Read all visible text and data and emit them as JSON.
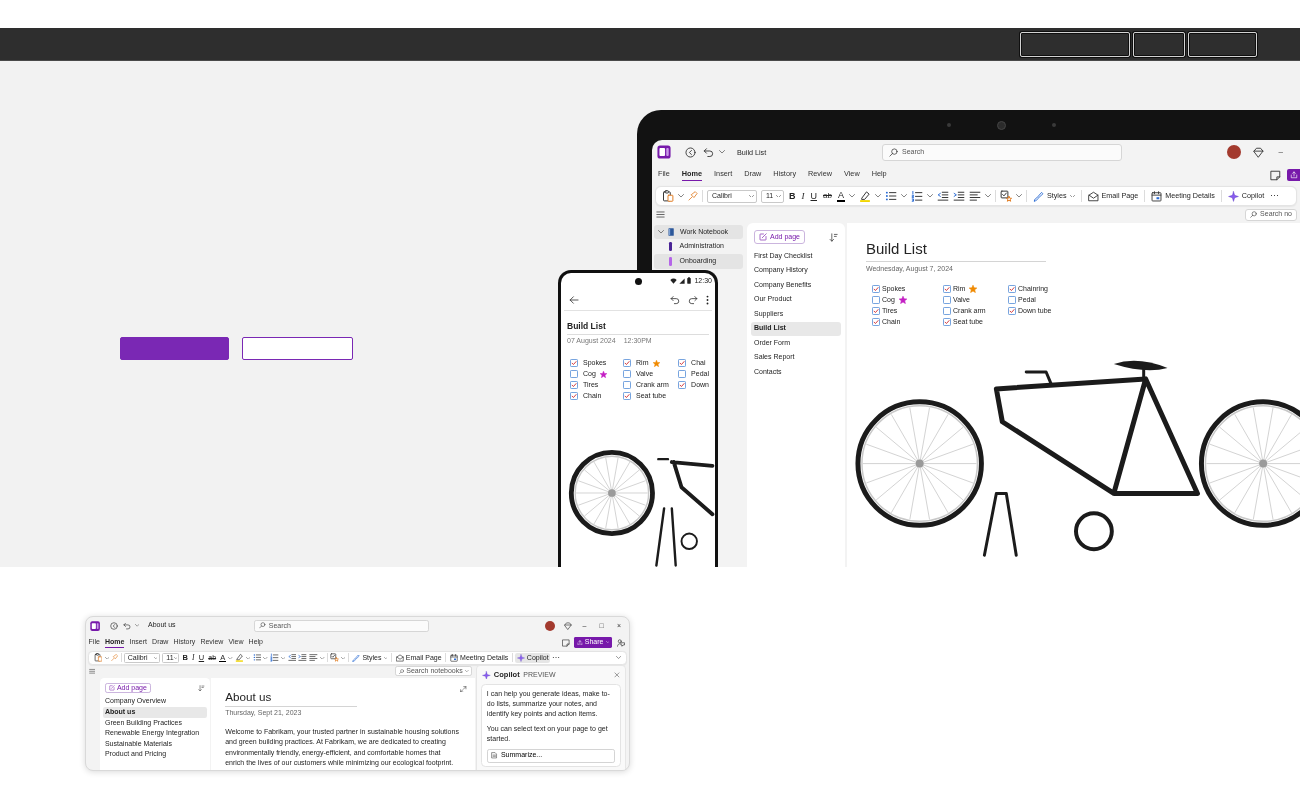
{
  "top_bar": {
    "buttons": [
      {
        "kind": "outline"
      },
      {
        "kind": "outline"
      },
      {
        "kind": "outline"
      }
    ]
  },
  "hero": {
    "buttons": [
      {
        "kind": "filled"
      },
      {
        "kind": "outline"
      }
    ]
  },
  "laptop_app": {
    "kind": "cropped",
    "title": "Build List",
    "search": {
      "placeholder": "Search"
    },
    "window_controls": [
      "–"
    ],
    "menu": [
      {
        "label": "File",
        "selected": false
      },
      {
        "label": "Home",
        "selected": true
      },
      {
        "label": "Insert",
        "selected": false
      },
      {
        "label": "Draw",
        "selected": false
      },
      {
        "label": "History",
        "selected": false
      },
      {
        "label": "Review",
        "selected": false
      },
      {
        "label": "View",
        "selected": false
      },
      {
        "label": "Help",
        "selected": false
      }
    ],
    "share_button": {
      "kind": "cropped"
    },
    "ribbon": {
      "font": "Calibri",
      "font_size": "11",
      "format": [
        "B",
        "I",
        "U",
        "ab"
      ],
      "font_color": "A",
      "commands": [
        {
          "label": "Styles",
          "selected": false
        },
        {
          "label": "Email Page",
          "selected": false
        },
        {
          "label": "Meeting Details",
          "selected": false
        },
        {
          "label": "Copilot",
          "selected": false
        }
      ],
      "more": "⋯"
    },
    "notebook_search": {
      "placeholder": "Search no"
    },
    "notebook": {
      "name": "Work Notebook",
      "expanded": true,
      "sections": [
        {
          "name": "Administration",
          "color": "#4a2596",
          "selected": false
        },
        {
          "name": "Onboarding",
          "color": "#b565e8",
          "selected": true
        }
      ]
    },
    "pages_pane": {
      "add_page": "Add page",
      "pages": [
        {
          "title": "First Day Checklist",
          "selected": false
        },
        {
          "title": "Company History",
          "selected": false
        },
        {
          "title": "Company Benefits",
          "selected": false
        },
        {
          "title": "Our Product",
          "selected": false
        },
        {
          "title": "Suppliers",
          "selected": false
        },
        {
          "title": "Build List",
          "selected": true
        },
        {
          "title": "Order Form",
          "selected": false
        },
        {
          "title": "Sales Report",
          "selected": false
        },
        {
          "title": "Contacts",
          "selected": false
        }
      ]
    },
    "page": {
      "kind": "checklist",
      "title": "Build List",
      "date": "Wednesday, August 7, 2024",
      "columns": [
        {
          "items": [
            {
              "label": "Spokes",
              "checked": true,
              "starred": false
            },
            {
              "label": "Cog",
              "checked": false,
              "starred": true,
              "color": "#c41fc4"
            },
            {
              "label": "Tires",
              "checked": true,
              "starred": false
            },
            {
              "label": "Chain",
              "checked": true,
              "starred": false
            }
          ]
        },
        {
          "items": [
            {
              "label": "Rim",
              "checked": true,
              "starred": true,
              "color": "#f08a00"
            },
            {
              "label": "Valve",
              "checked": false,
              "starred": false
            },
            {
              "label": "Crank arm",
              "checked": false,
              "starred": false
            },
            {
              "label": "Seat tube",
              "checked": true,
              "starred": false
            }
          ]
        },
        {
          "items": [
            {
              "label": "Chainring",
              "checked": true,
              "starred": false
            },
            {
              "label": "Pedal",
              "checked": false,
              "starred": false
            },
            {
              "label": "Down tube",
              "checked": true,
              "starred": false
            }
          ]
        }
      ]
    }
  },
  "phone_app": {
    "status_time": "12:30",
    "page": {
      "kind": "checklist",
      "title": "Build List",
      "date": "07 August 2024",
      "time": "12:30PM",
      "columns": [
        {
          "items": [
            {
              "label": "Spokes",
              "checked": true,
              "starred": false
            },
            {
              "label": "Cog",
              "checked": false,
              "starred": true,
              "color": "#c41fc4"
            },
            {
              "label": "Tires",
              "checked": true,
              "starred": false
            },
            {
              "label": "Chain",
              "checked": true,
              "starred": false
            }
          ]
        },
        {
          "items": [
            {
              "label": "Rim",
              "checked": true,
              "starred": true,
              "color": "#f08a00"
            },
            {
              "label": "Valve",
              "checked": false,
              "starred": false
            },
            {
              "label": "Crank arm",
              "checked": false,
              "starred": false
            },
            {
              "label": "Seat tube",
              "checked": true,
              "starred": false
            }
          ]
        },
        {
          "items": [
            {
              "label": "Chai",
              "checked": true,
              "starred": false
            },
            {
              "label": "Pedal",
              "checked": false,
              "starred": false
            },
            {
              "label": "Down",
              "checked": true,
              "starred": false
            }
          ]
        }
      ]
    }
  },
  "desktop_app": {
    "kind": "full",
    "title": "About us",
    "search": {
      "placeholder": "Search"
    },
    "window_controls": [
      "–",
      "□",
      "×"
    ],
    "menu": [
      {
        "label": "File",
        "selected": false
      },
      {
        "label": "Home",
        "selected": true
      },
      {
        "label": "Insert",
        "selected": false
      },
      {
        "label": "Draw",
        "selected": false
      },
      {
        "label": "History",
        "selected": false
      },
      {
        "label": "Review",
        "selected": false
      },
      {
        "label": "View",
        "selected": false
      },
      {
        "label": "Help",
        "selected": false
      }
    ],
    "share_button": {
      "kind": "full",
      "label": "Share"
    },
    "ribbon": {
      "font": "Calibri",
      "font_size": "11",
      "format": [
        "B",
        "I",
        "U",
        "ab"
      ],
      "font_color": "A",
      "commands": [
        {
          "label": "Styles",
          "selected": false
        },
        {
          "label": "Email Page",
          "selected": false
        },
        {
          "label": "Meeting Details",
          "selected": false
        },
        {
          "label": "Copilot",
          "selected": true
        }
      ],
      "more": "⋯"
    },
    "notebook_search": {
      "placeholder": "Search notebooks"
    },
    "pages_pane": {
      "add_page": "Add page",
      "pages": [
        {
          "title": "Company Overview",
          "selected": false
        },
        {
          "title": "About us",
          "selected": true
        },
        {
          "title": "Green Building Practices",
          "selected": false
        },
        {
          "title": "Renewable Energy Integration",
          "selected": false
        },
        {
          "title": "Sustainable Materials",
          "selected": false
        },
        {
          "title": "Product and Pricing",
          "selected": false
        }
      ]
    },
    "page": {
      "kind": "text",
      "title": "About us",
      "date": "Thursday, Sept 21, 2023",
      "paragraphs": [
        "Welcome to Fabrikam, your trusted partner in sustainable housing solutions and green building practices. At Fabrikam, we are dedicated to creating environmentally friendly, energy-efficient, and comfortable homes that enrich the lives of our customers while minimizing our ecological footprint."
      ]
    },
    "copilot_pane": {
      "title": "Copilot",
      "badge": "PREVIEW",
      "messages": [
        "I can help you generate ideas, make to-do lists, summarize your notes, and identify key points and action items.",
        "You can select text on your page to get started."
      ],
      "suggestions": [
        "Summarize..."
      ]
    }
  }
}
